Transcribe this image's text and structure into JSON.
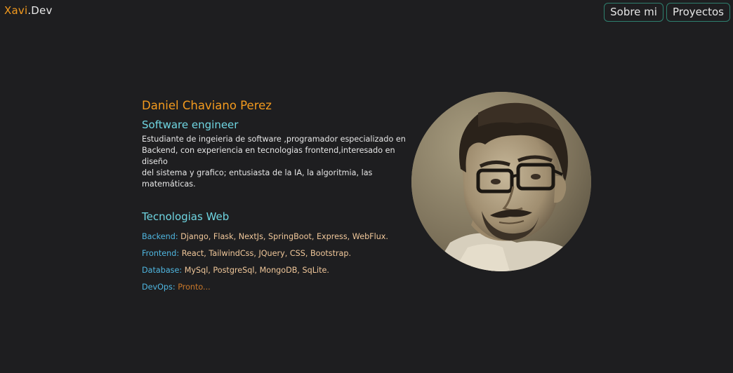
{
  "header": {
    "logo_part1": "Xavi",
    "logo_part2": ".Dev",
    "nav": [
      {
        "label": "Sobre mi"
      },
      {
        "label": "Proyectos"
      }
    ]
  },
  "profile": {
    "name": "Daniel Chaviano Perez",
    "role": "Software engineer",
    "description_lines": [
      "Estudiante de ingeieria de software ,programador especializado en",
      "Backend, con experiencia en tecnologias frontend,interesado en diseño",
      "del sistema y grafico; entusiasta de la IA, la algoritmia, las matemáticas."
    ]
  },
  "tech": {
    "title": "Tecnologias Web",
    "rows": [
      {
        "label": "Backend:",
        "value": "Django, Flask, NextJs, SpringBoot, Express, WebFlux."
      },
      {
        "label": "Frontend:",
        "value": "React, TailwindCss, JQuery, CSS, Bootstrap."
      },
      {
        "label": "Database:",
        "value": "MySql, PostgreSql, MongoDB, SqLite."
      },
      {
        "label": "DevOps:",
        "value": "Pronto..."
      }
    ]
  },
  "colors": {
    "background": "#1e1e20",
    "accent_orange": "#f39a1e",
    "accent_cyan": "#6fd6e2",
    "label_blue": "#4fb6e0",
    "value_peach": "#f0c79a",
    "nav_border": "#2e7f6e"
  }
}
